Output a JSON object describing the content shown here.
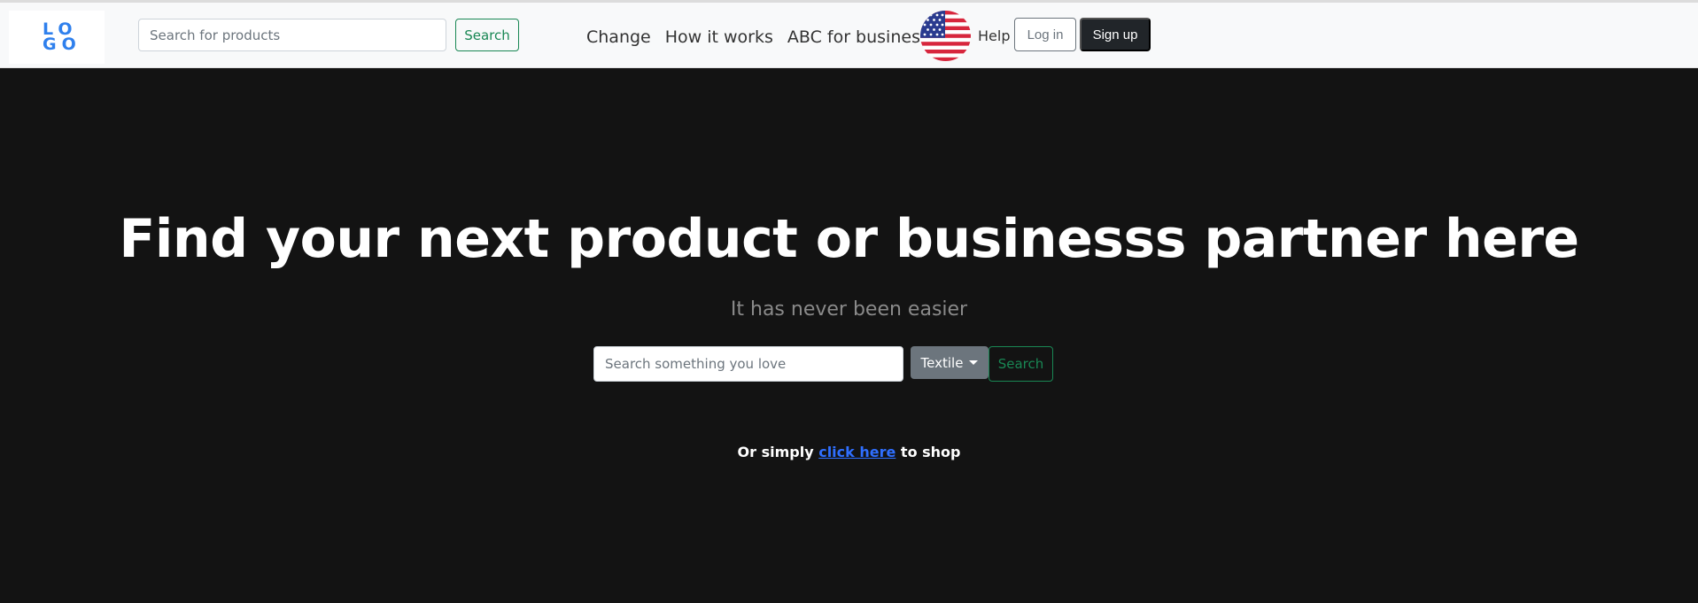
{
  "navbar": {
    "logo": {
      "text_top": "LO",
      "text_bottom": "GO"
    },
    "search": {
      "placeholder": "Search for products",
      "button_label": "Search"
    },
    "links": [
      "Change",
      "How it works",
      "ABC for business"
    ],
    "flag_icon": "us-flag-icon",
    "help_label": "Help",
    "login_label": "Log in",
    "signup_label": "Sign up"
  },
  "hero": {
    "title": "Find your next product or businesss partner here",
    "subtitle": "It has never been easier",
    "search": {
      "placeholder": "Search something you love",
      "category_selected": "Textile",
      "button_label": "Search"
    },
    "shop_line": {
      "prefix": "Or simply ",
      "link_text": "click here",
      "suffix": " to shop"
    }
  },
  "colors": {
    "background": "#131313",
    "navbar": "#f8f9fa",
    "accent_green": "#198754",
    "logo_blue": "#2f80ed",
    "link_blue": "#2f6fff",
    "dropdown_gray": "#6c757d"
  }
}
